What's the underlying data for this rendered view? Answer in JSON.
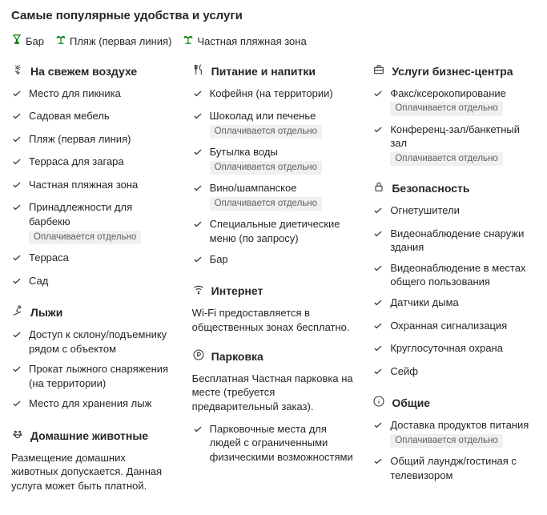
{
  "title": "Самые популярные удобства и услуги",
  "top": [
    {
      "icon": "glass",
      "label": "Бар"
    },
    {
      "icon": "palm",
      "label": "Пляж (первая линия)"
    },
    {
      "icon": "palm",
      "label": "Частная пляжная зона"
    }
  ],
  "paid_label": "Оплачивается отдельно",
  "columns": [
    [
      {
        "icon": "flower",
        "title": "На свежем воздухе",
        "items": [
          {
            "text": "Место для пикника"
          },
          {
            "text": "Садовая мебель"
          },
          {
            "text": "Пляж (первая линия)"
          },
          {
            "text": "Терраса для загара"
          },
          {
            "text": "Частная пляжная зона"
          },
          {
            "text": "Принадлежности для барбекю",
            "paid": true
          },
          {
            "text": "Терраса"
          },
          {
            "text": "Сад"
          }
        ]
      },
      {
        "icon": "ski",
        "title": "Лыжи",
        "items": [
          {
            "text": "Доступ к склону/подъемнику рядом с объектом"
          },
          {
            "text": "Прокат лыжного снаряжения (на территории)"
          },
          {
            "text": "Место для хранения лыж"
          }
        ]
      },
      {
        "icon": "paw",
        "title": "Домашние животные",
        "desc": "Размещение домашних животных допускается. Данная услуга может быть платной."
      }
    ],
    [
      {
        "icon": "food",
        "title": "Питание и напитки",
        "items": [
          {
            "text": "Кофейня (на территории)"
          },
          {
            "text": "Шоколад или печенье",
            "paid": true
          },
          {
            "text": "Бутылка воды",
            "paid": true
          },
          {
            "text": "Вино/шампанское",
            "paid": true
          },
          {
            "text": "Специальные диетические меню (по запросу)"
          },
          {
            "text": "Бар"
          }
        ]
      },
      {
        "icon": "wifi",
        "title": "Интернет",
        "desc": "Wi-Fi предоставляется в общественных зонах бесплатно."
      },
      {
        "icon": "parking",
        "title": "Парковка",
        "desc": "Бесплатная Частная парковка на месте (требуется предварительный заказ).",
        "items": [
          {
            "text": "Парковочные места для людей с ограниченными физическими возможностями"
          }
        ]
      }
    ],
    [
      {
        "icon": "briefcase",
        "title": "Услуги бизнес-центра",
        "items": [
          {
            "text": "Факс/ксерокопирование",
            "paid": true
          },
          {
            "text": "Конференц-зал/банкетный зал",
            "paid": true
          }
        ]
      },
      {
        "icon": "lock",
        "title": "Безопасность",
        "items": [
          {
            "text": "Огнетушители"
          },
          {
            "text": "Видеонаблюдение снаружи здания"
          },
          {
            "text": "Видеонаблюдение в местах общего пользования"
          },
          {
            "text": "Датчики дыма"
          },
          {
            "text": "Охранная сигнализация"
          },
          {
            "text": "Круглосуточная охрана"
          },
          {
            "text": "Сейф"
          }
        ]
      },
      {
        "icon": "info",
        "title": "Общие",
        "items": [
          {
            "text": "Доставка продуктов питания",
            "paid": true
          },
          {
            "text": "Общий лаундж/гостиная с телевизором"
          }
        ]
      }
    ]
  ]
}
